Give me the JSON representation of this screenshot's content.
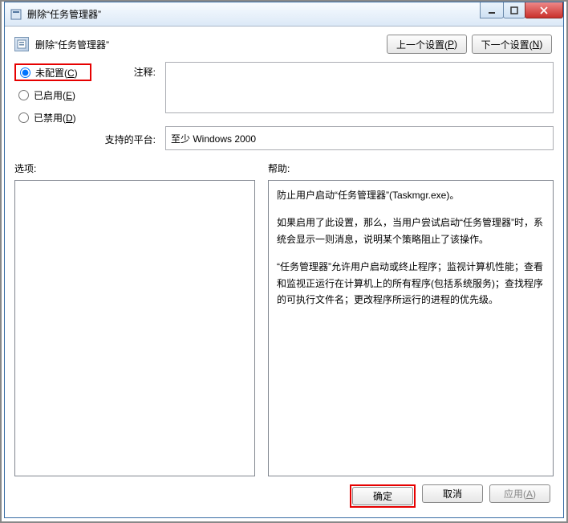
{
  "window": {
    "title": "删除“任务管理器”"
  },
  "header": {
    "setting_name": "删除“任务管理器”",
    "prev_setting_label": "上一个设置(",
    "prev_setting_key": "P",
    "prev_setting_tail": ")",
    "next_setting_label": "下一个设置(",
    "next_setting_key": "N",
    "next_setting_tail": ")"
  },
  "radios": {
    "not_configured": {
      "label": "未配置(",
      "key": "C",
      "tail": ")"
    },
    "enabled": {
      "label": "已启用(",
      "key": "E",
      "tail": ")"
    },
    "disabled": {
      "label": "已禁用(",
      "key": "D",
      "tail": ")"
    },
    "selected": "not_configured"
  },
  "labels": {
    "comment": "注释:",
    "platform": "支持的平台:",
    "options": "选项:",
    "help": "帮助:"
  },
  "comment_text": "",
  "platform_text": "至少 Windows 2000",
  "help_paragraphs": [
    "防止用户启动“任务管理器”(Taskmgr.exe)。",
    "如果启用了此设置，那么，当用户尝试启动“任务管理器”时，系统会显示一则消息，说明某个策略阻止了该操作。",
    "“任务管理器”允许用户启动或终止程序；监视计算机性能；查看和监视正运行在计算机上的所有程序(包括系统服务)；查找程序的可执行文件名；更改程序所运行的进程的优先级。"
  ],
  "footer": {
    "ok": "确定",
    "cancel": "取消",
    "apply_label": "应用(",
    "apply_key": "A",
    "apply_tail": ")"
  }
}
